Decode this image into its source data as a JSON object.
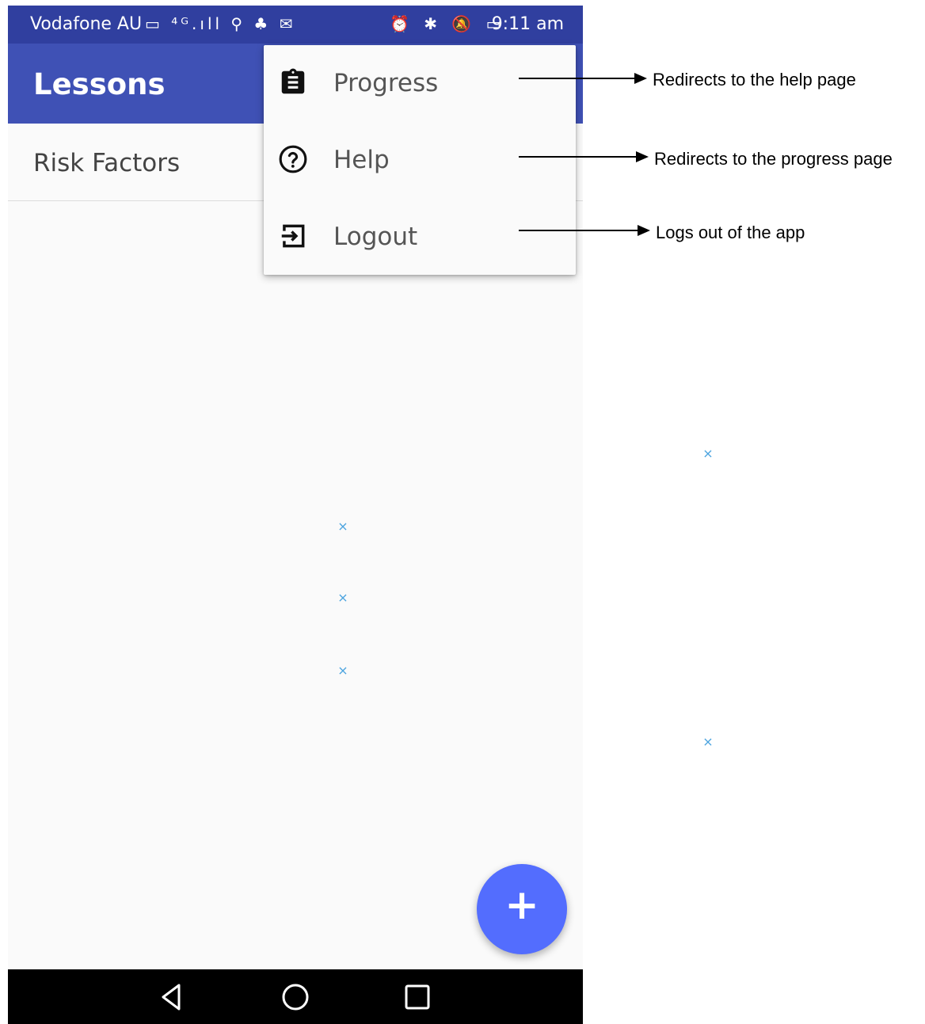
{
  "status_bar": {
    "carrier": "Vodafone AU",
    "left_icons": "▭ ⁴ᴳ.ıll ⚲ ♣ ✉",
    "right_icons": "⏰ ✱ 🔕 ▭",
    "time": "9:11 am"
  },
  "app_bar": {
    "title": "Lessons"
  },
  "list": {
    "items": [
      "Risk Factors"
    ]
  },
  "menu": {
    "items": [
      {
        "label": "Progress",
        "icon": "clipboard-icon"
      },
      {
        "label": "Help",
        "icon": "help-circle-icon"
      },
      {
        "label": "Logout",
        "icon": "logout-icon"
      }
    ]
  },
  "fab": {
    "symbol": "+"
  },
  "annotations": [
    "Redirects to the help page",
    "Redirects to the progress page",
    "Logs out of the app"
  ],
  "markers": [
    "×",
    "×",
    "×",
    "×",
    "×"
  ],
  "colors": {
    "status_bar": "#303f9f",
    "app_bar": "#3f51b5",
    "fab": "#536dfe",
    "marker": "#4aa3df"
  }
}
